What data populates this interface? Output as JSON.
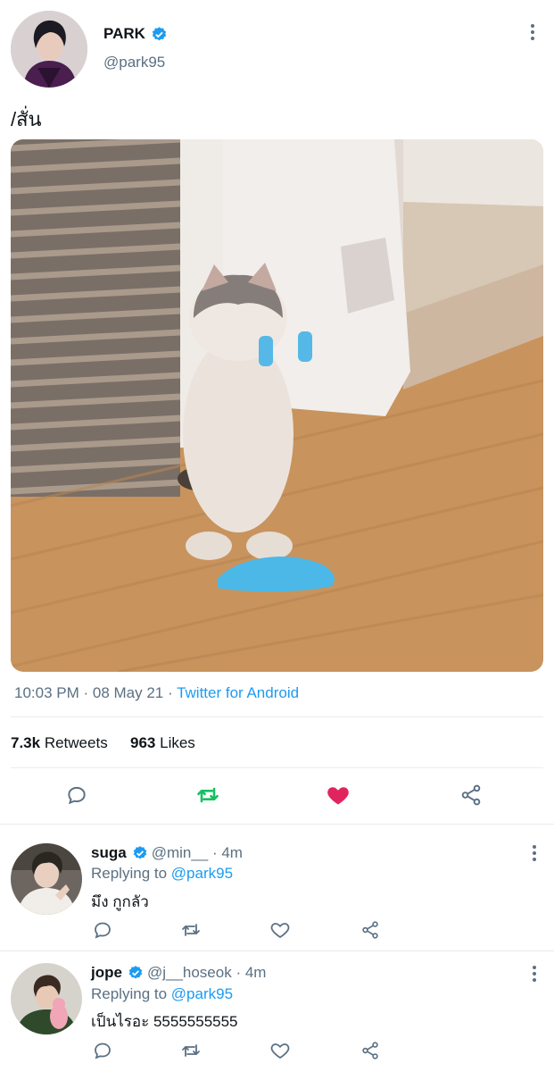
{
  "tweet": {
    "author": {
      "name": "PARK",
      "handle": "@park95",
      "verified": true
    },
    "text": "/สั่น",
    "timestamp": "10:03 PM · 08 May 21 · ",
    "source": "Twitter for Android",
    "stats": {
      "retweets_count": "7.3k",
      "retweets_label": "Retweets",
      "likes_count": "963",
      "likes_label": "Likes"
    },
    "actions": [
      "reply-icon",
      "retweet-icon",
      "like-icon",
      "share-icon"
    ],
    "liked": true,
    "retweeted": true
  },
  "replies": [
    {
      "name": "suga",
      "handle": "@min__ · 4m",
      "verified": true,
      "replying_prefix": "Replying to ",
      "replying_to": "@park95",
      "text": "มึง กูกลัว"
    },
    {
      "name": "jope",
      "handle": "@j__hoseok · 4m",
      "verified": true,
      "replying_prefix": "Replying to ",
      "replying_to": "@park95",
      "text": "เป็นไรอะ 5555555555"
    }
  ],
  "colors": {
    "accent": "#1d9bf0",
    "retweet_active": "#17bf63",
    "like_active": "#e0245e",
    "muted": "#5b7083",
    "divider": "#e6ecf0"
  }
}
